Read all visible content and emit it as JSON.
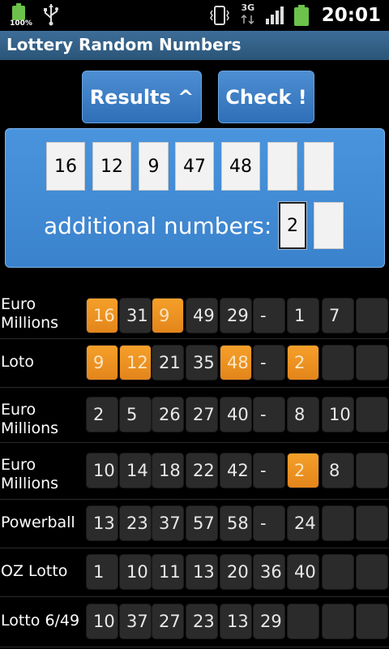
{
  "status_bar": {
    "battery_percent": "100%",
    "network": "3G",
    "time": "20:01",
    "icons": [
      "battery-icon",
      "usb-icon",
      "vibrate-icon",
      "3g-icon",
      "signal-icon",
      "battery-icon"
    ]
  },
  "title": "Lottery Random Numbers",
  "buttons": {
    "results": "Results  ^",
    "check": "Check !"
  },
  "input": {
    "numbers": [
      "16",
      "12",
      "9",
      "47",
      "48",
      "",
      ""
    ],
    "additional_label": "additional numbers:",
    "additional": [
      "2",
      ""
    ]
  },
  "results": [
    {
      "name": "Euro Millions",
      "numbers": [
        "16",
        "31",
        "9",
        "49",
        "29"
      ],
      "sep": "-",
      "extra": [
        "1",
        "7",
        ""
      ],
      "highlight_main": [
        0,
        2
      ],
      "highlight_extra": []
    },
    {
      "name": "Loto",
      "numbers": [
        "9",
        "12",
        "21",
        "35",
        "48"
      ],
      "sep": "-",
      "extra": [
        "2",
        "",
        ""
      ],
      "highlight_main": [
        0,
        1,
        4
      ],
      "highlight_extra": [
        0
      ]
    },
    {
      "name": "Euro Millions",
      "numbers": [
        "2",
        "5",
        "26",
        "27",
        "40"
      ],
      "sep": "-",
      "extra": [
        "8",
        "10",
        ""
      ],
      "highlight_main": [],
      "highlight_extra": []
    },
    {
      "name": "Euro Millions",
      "numbers": [
        "10",
        "14",
        "18",
        "22",
        "42"
      ],
      "sep": "-",
      "extra": [
        "2",
        "8",
        ""
      ],
      "highlight_main": [],
      "highlight_extra": [
        0
      ]
    },
    {
      "name": "Powerball",
      "numbers": [
        "13",
        "23",
        "37",
        "57",
        "58"
      ],
      "sep": "-",
      "extra": [
        "24",
        "",
        ""
      ],
      "highlight_main": [],
      "highlight_extra": []
    },
    {
      "name": "OZ Lotto",
      "numbers": [
        "1",
        "10",
        "11",
        "13",
        "20",
        "36",
        "40"
      ],
      "sep": "",
      "extra": [
        "",
        ""
      ],
      "highlight_main": [],
      "highlight_extra": []
    },
    {
      "name": "Lotto 6/49",
      "numbers": [
        "10",
        "37",
        "27",
        "23",
        "13",
        "29"
      ],
      "sep": "",
      "extra": [
        "",
        "",
        ""
      ],
      "highlight_main": [],
      "highlight_extra": []
    }
  ],
  "colors": {
    "highlight": "#ef9522",
    "button": "#3a7cc4",
    "panel": "#4a94de",
    "title_bar": "#34608a"
  }
}
